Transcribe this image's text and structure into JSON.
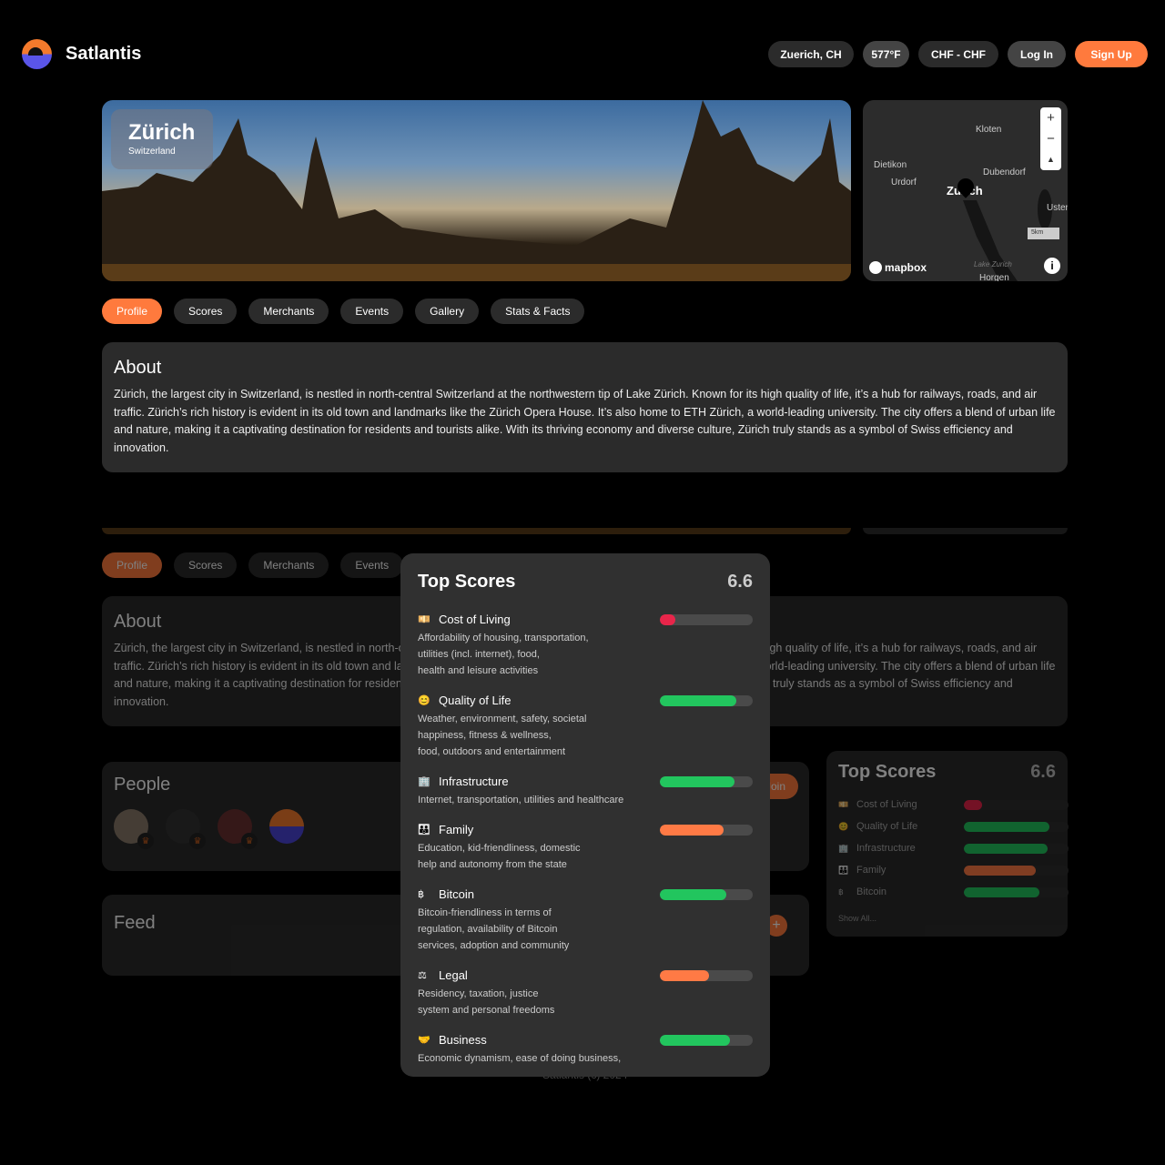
{
  "header": {
    "brand": "Satlantis",
    "location": "Zuerich, CH",
    "temperature": "577°F",
    "currency": "CHF - CHF",
    "login": "Log In",
    "signup": "Sign Up"
  },
  "hero": {
    "city": "Zürich",
    "country": "Switzerland"
  },
  "map": {
    "labels": [
      "Kloten",
      "Dietikon",
      "Urdorf",
      "Dubendorf",
      "Zurich",
      "Uster",
      "Lake Zurich",
      "Horgen"
    ],
    "scale": "5km",
    "attribution": "mapbox",
    "zoom_in": "+",
    "zoom_out": "−"
  },
  "tabs": [
    "Profile",
    "Scores",
    "Merchants",
    "Events",
    "Gallery",
    "Stats & Facts"
  ],
  "about": {
    "title": "About",
    "text": "Zürich, the largest city in Switzerland, is nestled in north-central Switzerland at the northwestern tip of Lake Zürich. Known for its high quality of life, it’s a hub for railways, roads, and air traffic. Zürich’s rich history is evident in its old town and landmarks like the Zürich Opera House. It’s also home to ETH Zürich, a world-leading university. The city offers a blend of urban life and nature, making it a captivating destination for residents and tourists alike. With its thriving economy and diverse culture, Zürich truly stands as a symbol of Swiss efficiency and innovation."
  },
  "people": {
    "title": "People",
    "join": "Join"
  },
  "feed": {
    "title": "Feed",
    "add": "+"
  },
  "footer": "Satlantis (c) 2024",
  "colors": {
    "accent": "#ff7a3d",
    "good": "#22c55e",
    "mid": "#ff7a45",
    "bad": "#e8254a"
  },
  "top_scores": {
    "title": "Top Scores",
    "score": "6.6",
    "show_all": "Show All...",
    "items": [
      {
        "icon": "💴",
        "label": "Cost of Living",
        "desc": "Affordability of housing, transportation,\nutilities (incl. internet), food,\nhealth and leisure activities",
        "value": 0.17,
        "color": "#e8254a"
      },
      {
        "icon": "😊",
        "label": "Quality of Life",
        "desc": "Weather, environment, safety, societal\nhappiness, fitness & wellness,\nfood, outdoors and entertainment",
        "value": 0.82,
        "color": "#22c55e"
      },
      {
        "icon": "🏢",
        "label": "Infrastructure",
        "desc": "Internet, transportation, utilities and healthcare",
        "value": 0.8,
        "color": "#22c55e"
      },
      {
        "icon": "👪",
        "label": "Family",
        "desc": "Education, kid-friendliness, domestic\nhelp and autonomy from the state",
        "value": 0.69,
        "color": "#ff7a45"
      },
      {
        "icon": "฿",
        "label": "Bitcoin",
        "desc": "Bitcoin-friendliness in terms of\nregulation, availability of Bitcoin\nservices, adoption and community",
        "value": 0.72,
        "color": "#22c55e"
      },
      {
        "icon": "⚖",
        "label": "Legal",
        "desc": "Residency, taxation, justice\nsystem and personal freedoms",
        "value": 0.53,
        "color": "#ff7a45"
      },
      {
        "icon": "🤝",
        "label": "Business",
        "desc": "Economic dynamism, ease of doing business,",
        "value": 0.75,
        "color": "#22c55e"
      }
    ]
  }
}
